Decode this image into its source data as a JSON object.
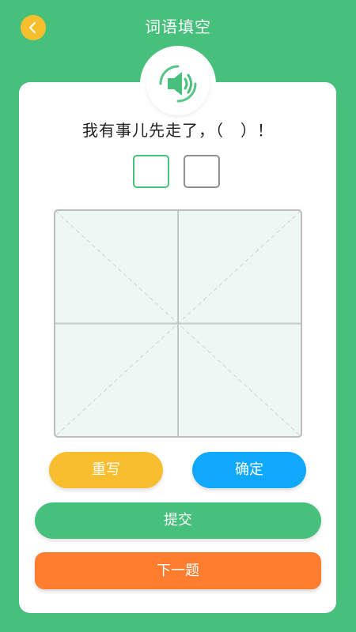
{
  "header": {
    "title": "词语填空",
    "back_icon": "chevron-left-icon"
  },
  "question": {
    "speaker_icon": "speaker-icon",
    "text": "我有事儿先走了，（　）！"
  },
  "answer_slots": [
    "",
    ""
  ],
  "buttons": {
    "rewrite": "重写",
    "confirm": "确定",
    "submit": "提交",
    "next": "下一题"
  },
  "colors": {
    "background": "#47c07c",
    "card": "#ffffff",
    "back_button": "#f7bf2b",
    "rewrite": "#f9be2f",
    "confirm": "#0fa8fb",
    "submit": "#47c07c",
    "next": "#fe7d2e"
  }
}
